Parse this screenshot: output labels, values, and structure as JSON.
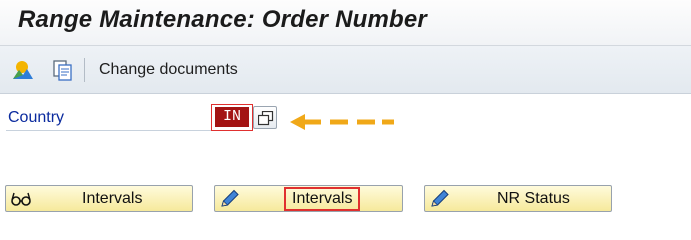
{
  "window": {
    "title": "Range Maintenance: Order Number"
  },
  "toolbar": {
    "icons": [
      "display-icon",
      "copy-documents-icon"
    ],
    "change_documents_label": "Change documents"
  },
  "country": {
    "label": "Country",
    "value": "IN"
  },
  "annotation": {
    "arrow_color": "#f0a818",
    "highlight_color": "#e0302f"
  },
  "buttons": {
    "intervals_display_label": "Intervals",
    "intervals_change_label": "Intervals",
    "nr_status_label": "NR Status"
  },
  "colors": {
    "button_bg": "#f9ecac",
    "title_text": "#1b1b1b",
    "label_blue": "#0a2a9e",
    "field_red": "#a31414"
  }
}
